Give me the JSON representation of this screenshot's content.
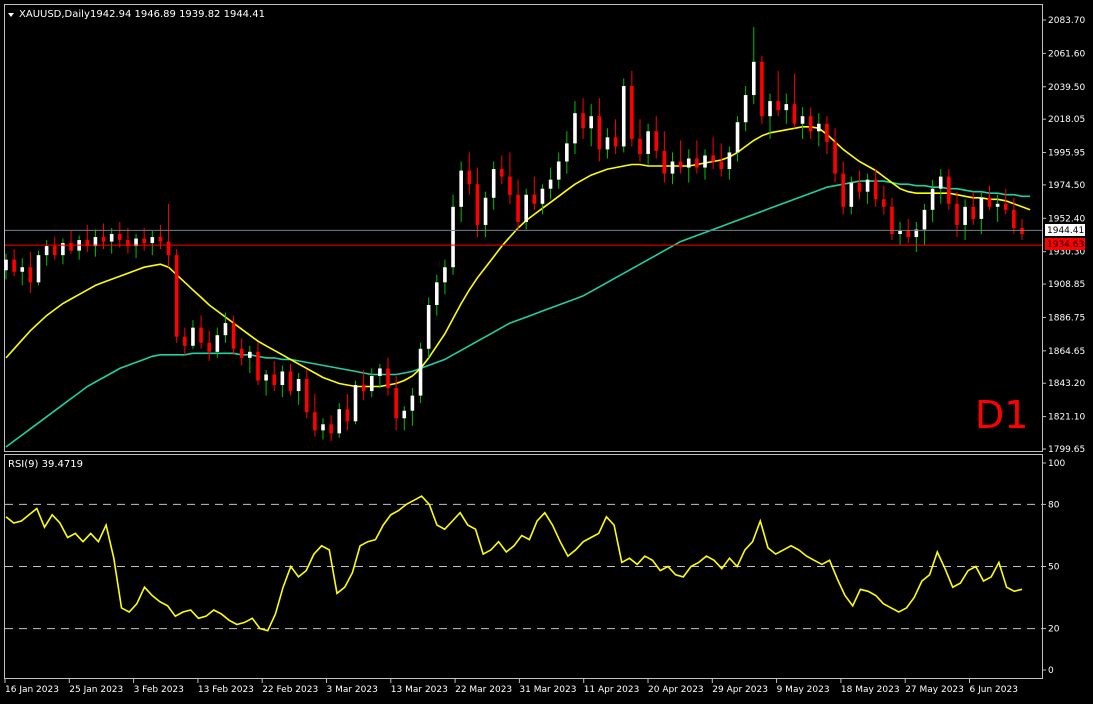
{
  "header": {
    "symbol_label": "XAUUSD,Daily",
    "ohlc_values": "1942.94 1946.89 1939.82 1944.41"
  },
  "timeframe_label": "D1",
  "price_tags": {
    "bid": "1944.41",
    "level": "1934.63"
  },
  "indicator": {
    "label": "RSI(9) 39.4719"
  },
  "colors": {
    "background": "#000000",
    "frame": "#c0c0c0",
    "bull_candle_body": "#ffffff",
    "bull_candle_wick": "#00c000",
    "bear_candle_body": "#ff0000",
    "bear_candle_wick": "#ff0000",
    "ma_fast": "#ffff00",
    "ma_slow": "#20d0a0",
    "rsi_line": "#ffff00",
    "level_line": "#ff0000",
    "bid_line": "#708090",
    "timeframe_label": "#ff0000",
    "axis_text": "#ffffff"
  },
  "chart_data": [
    {
      "type": "candlestick",
      "title": "XAUUSD,Daily",
      "y_ticks": [
        "2083.70",
        "2061.60",
        "2039.50",
        "2018.05",
        "1995.95",
        "1974.50",
        "1952.40",
        "1930.30",
        "1908.85",
        "1886.75",
        "1864.65",
        "1843.20",
        "1821.10",
        "1799.65"
      ],
      "ylim": [
        1799.65,
        2083.7
      ],
      "x_ticks": [
        "16 Jan 2023",
        "25 Jan 2023",
        "3 Feb 2023",
        "13 Feb 2023",
        "22 Feb 2023",
        "3 Mar 2023",
        "13 Mar 2023",
        "22 Mar 2023",
        "31 Mar 2023",
        "11 Apr 2023",
        "20 Apr 2023",
        "29 Apr 2023",
        "9 May 2023",
        "18 May 2023",
        "27 May 2023",
        "6 Jun 2023"
      ],
      "horizontal_levels": [
        1944.41,
        1934.63
      ],
      "candles": [
        [
          1918,
          1929,
          1912,
          1925
        ],
        [
          1925,
          1932,
          1914,
          1917
        ],
        [
          1917,
          1926,
          1908,
          1920
        ],
        [
          1920,
          1930,
          1903,
          1910
        ],
        [
          1910,
          1931,
          1908,
          1928
        ],
        [
          1928,
          1938,
          1921,
          1934
        ],
        [
          1934,
          1940,
          1925,
          1928
        ],
        [
          1928,
          1939,
          1922,
          1936
        ],
        [
          1936,
          1944,
          1929,
          1931
        ],
        [
          1931,
          1941,
          1925,
          1938
        ],
        [
          1938,
          1948,
          1930,
          1934
        ],
        [
          1934,
          1945,
          1927,
          1940
        ],
        [
          1940,
          1949,
          1932,
          1937
        ],
        [
          1937,
          1946,
          1929,
          1942
        ],
        [
          1942,
          1950,
          1933,
          1938
        ],
        [
          1938,
          1946,
          1929,
          1934
        ],
        [
          1934,
          1942,
          1926,
          1939
        ],
        [
          1939,
          1946,
          1931,
          1936
        ],
        [
          1936,
          1944,
          1928,
          1940
        ],
        [
          1940,
          1948,
          1932,
          1937
        ],
        [
          1937,
          1962,
          1920,
          1928
        ],
        [
          1928,
          1932,
          1870,
          1874
        ],
        [
          1874,
          1880,
          1862,
          1868
        ],
        [
          1868,
          1885,
          1866,
          1880
        ],
        [
          1880,
          1888,
          1866,
          1870
        ],
        [
          1870,
          1878,
          1858,
          1864
        ],
        [
          1864,
          1880,
          1860,
          1875
        ],
        [
          1875,
          1890,
          1870,
          1883
        ],
        [
          1883,
          1888,
          1862,
          1866
        ],
        [
          1866,
          1873,
          1855,
          1860
        ],
        [
          1860,
          1868,
          1850,
          1864
        ],
        [
          1864,
          1870,
          1842,
          1845
        ],
        [
          1845,
          1852,
          1835,
          1849
        ],
        [
          1849,
          1858,
          1838,
          1842
        ],
        [
          1842,
          1855,
          1834,
          1851
        ],
        [
          1851,
          1856,
          1835,
          1838
        ],
        [
          1838,
          1850,
          1829,
          1846
        ],
        [
          1846,
          1852,
          1820,
          1824
        ],
        [
          1824,
          1836,
          1808,
          1812
        ],
        [
          1812,
          1820,
          1806,
          1816
        ],
        [
          1816,
          1822,
          1805,
          1810
        ],
        [
          1810,
          1830,
          1807,
          1826
        ],
        [
          1826,
          1836,
          1812,
          1818
        ],
        [
          1818,
          1845,
          1816,
          1842
        ],
        [
          1842,
          1852,
          1832,
          1838
        ],
        [
          1838,
          1853,
          1834,
          1848
        ],
        [
          1848,
          1856,
          1840,
          1853
        ],
        [
          1853,
          1860,
          1835,
          1840
        ],
        [
          1840,
          1848,
          1812,
          1820
        ],
        [
          1820,
          1828,
          1812,
          1825
        ],
        [
          1825,
          1840,
          1815,
          1835
        ],
        [
          1835,
          1870,
          1830,
          1866
        ],
        [
          1866,
          1900,
          1860,
          1895
        ],
        [
          1895,
          1915,
          1888,
          1910
        ],
        [
          1910,
          1925,
          1902,
          1920
        ],
        [
          1920,
          1968,
          1915,
          1960
        ],
        [
          1960,
          1990,
          1950,
          1984
        ],
        [
          1984,
          1996,
          1968,
          1975
        ],
        [
          1975,
          1986,
          1940,
          1948
        ],
        [
          1948,
          1970,
          1940,
          1966
        ],
        [
          1966,
          1990,
          1958,
          1985
        ],
        [
          1985,
          1994,
          1975,
          1980
        ],
        [
          1980,
          1996,
          1962,
          1968
        ],
        [
          1968,
          1978,
          1945,
          1950
        ],
        [
          1950,
          1972,
          1945,
          1968
        ],
        [
          1968,
          1980,
          1958,
          1962
        ],
        [
          1962,
          1975,
          1955,
          1972
        ],
        [
          1972,
          1986,
          1965,
          1978
        ],
        [
          1978,
          1996,
          1972,
          1990
        ],
        [
          1990,
          2010,
          1982,
          2002
        ],
        [
          2002,
          2030,
          1995,
          2022
        ],
        [
          2022,
          2032,
          2005,
          2012
        ],
        [
          2012,
          2028,
          2000,
          2020
        ],
        [
          2020,
          2032,
          1990,
          1998
        ],
        [
          1998,
          2012,
          1992,
          2006
        ],
        [
          2006,
          2018,
          1995,
          2000
        ],
        [
          2000,
          2045,
          1996,
          2040
        ],
        [
          2040,
          2050,
          2000,
          2005
        ],
        [
          2005,
          2018,
          1990,
          1995
        ],
        [
          1995,
          2015,
          1988,
          2010
        ],
        [
          2010,
          2020,
          1992,
          1997
        ],
        [
          1997,
          2010,
          1976,
          1982
        ],
        [
          1982,
          1996,
          1975,
          1990
        ],
        [
          1990,
          2004,
          1982,
          1986
        ],
        [
          1986,
          1998,
          1976,
          1992
        ],
        [
          1992,
          2004,
          1982,
          1986
        ],
        [
          1986,
          1998,
          1978,
          1994
        ],
        [
          1994,
          2006,
          1985,
          1990
        ],
        [
          1990,
          2002,
          1980,
          1985
        ],
        [
          1985,
          2000,
          1978,
          1996
        ],
        [
          1996,
          2020,
          1990,
          2016
        ],
        [
          2016,
          2040,
          2010,
          2034
        ],
        [
          2034,
          2079,
          2028,
          2056
        ],
        [
          2056,
          2060,
          2015,
          2020
        ],
        [
          2020,
          2035,
          2005,
          2030
        ],
        [
          2030,
          2050,
          2020,
          2024
        ],
        [
          2024,
          2035,
          2015,
          2028
        ],
        [
          2028,
          2048,
          2012,
          2015
        ],
        [
          2015,
          2026,
          2005,
          2020
        ],
        [
          2020,
          2026,
          2005,
          2010
        ],
        [
          2010,
          2022,
          2000,
          2015
        ],
        [
          2015,
          2020,
          1995,
          2003
        ],
        [
          2003,
          2012,
          1976,
          1982
        ],
        [
          1982,
          1990,
          1955,
          1960
        ],
        [
          1960,
          1980,
          1955,
          1976
        ],
        [
          1976,
          1984,
          1965,
          1970
        ],
        [
          1970,
          1982,
          1962,
          1978
        ],
        [
          1978,
          1985,
          1960,
          1965
        ],
        [
          1965,
          1974,
          1955,
          1960
        ],
        [
          1960,
          1966,
          1938,
          1942
        ],
        [
          1942,
          1950,
          1935,
          1944
        ],
        [
          1944,
          1952,
          1936,
          1940
        ],
        [
          1940,
          1950,
          1930,
          1945
        ],
        [
          1945,
          1962,
          1935,
          1958
        ],
        [
          1958,
          1978,
          1950,
          1972
        ],
        [
          1972,
          1985,
          1962,
          1980
        ],
        [
          1980,
          1985,
          1958,
          1962
        ],
        [
          1962,
          1970,
          1940,
          1948
        ],
        [
          1948,
          1965,
          1938,
          1960
        ],
        [
          1960,
          1970,
          1948,
          1952
        ],
        [
          1952,
          1970,
          1942,
          1966
        ],
        [
          1966,
          1974,
          1958,
          1960
        ],
        [
          1960,
          1968,
          1950,
          1962
        ],
        [
          1962,
          1972,
          1955,
          1958
        ],
        [
          1958,
          1966,
          1942,
          1946
        ],
        [
          1946,
          1952,
          1938,
          1942
        ]
      ],
      "series": [
        {
          "type": "line",
          "color": "#ffff00",
          "values": [
            1860,
            1866,
            1872,
            1878,
            1883,
            1888,
            1892,
            1896,
            1899,
            1902,
            1905,
            1908,
            1910,
            1912,
            1914,
            1916,
            1918,
            1920,
            1921,
            1922,
            1920,
            1915,
            1910,
            1905,
            1900,
            1895,
            1891,
            1887,
            1883,
            1879,
            1875,
            1871,
            1868,
            1865,
            1862,
            1859,
            1856,
            1853,
            1850,
            1847,
            1845,
            1843,
            1842,
            1841,
            1841,
            1841,
            1841,
            1842,
            1843,
            1845,
            1848,
            1853,
            1860,
            1868,
            1876,
            1886,
            1896,
            1905,
            1913,
            1920,
            1927,
            1934,
            1940,
            1946,
            1951,
            1955,
            1959,
            1963,
            1967,
            1971,
            1975,
            1978,
            1981,
            1983,
            1985,
            1986,
            1987,
            1988,
            1988,
            1987,
            1987,
            1987,
            1987,
            1987,
            1987,
            1988,
            1989,
            1990,
            1991,
            1993,
            1996,
            2000,
            2004,
            2007,
            2009,
            2010,
            2011,
            2012,
            2013,
            2013,
            2012,
            2008,
            2003,
            1998,
            1994,
            1990,
            1987,
            1984,
            1980,
            1976,
            1972,
            1970,
            1969,
            1969,
            1969,
            1969,
            1969,
            1968,
            1967,
            1966,
            1966,
            1965,
            1965,
            1964,
            1962,
            1960,
            1958
          ]
        },
        {
          "type": "line",
          "color": "#20d0a0",
          "values": [
            1801,
            1805,
            1809,
            1813,
            1817,
            1821,
            1825,
            1829,
            1833,
            1837,
            1841,
            1844,
            1847,
            1850,
            1853,
            1855,
            1857,
            1859,
            1861,
            1862,
            1862,
            1862,
            1862,
            1863,
            1863,
            1863,
            1863,
            1863,
            1863,
            1862,
            1862,
            1861,
            1860,
            1860,
            1859,
            1859,
            1858,
            1857,
            1856,
            1855,
            1854,
            1853,
            1852,
            1851,
            1850,
            1849,
            1849,
            1849,
            1849,
            1850,
            1851,
            1853,
            1855,
            1857,
            1859,
            1862,
            1865,
            1868,
            1871,
            1874,
            1877,
            1880,
            1883,
            1885,
            1887,
            1889,
            1891,
            1893,
            1895,
            1897,
            1899,
            1901,
            1904,
            1907,
            1910,
            1913,
            1916,
            1919,
            1922,
            1925,
            1928,
            1931,
            1934,
            1937,
            1939,
            1941,
            1943,
            1945,
            1947,
            1949,
            1951,
            1953,
            1955,
            1957,
            1959,
            1961,
            1963,
            1965,
            1967,
            1969,
            1971,
            1973,
            1974,
            1975,
            1976,
            1977,
            1977,
            1977,
            1977,
            1976,
            1975,
            1975,
            1974,
            1974,
            1973,
            1973,
            1972,
            1972,
            1971,
            1970,
            1970,
            1969,
            1969,
            1968,
            1968,
            1967,
            1967
          ]
        }
      ]
    },
    {
      "type": "line",
      "title": "RSI(9) 39.4719",
      "y_ticks": [
        "100",
        "80",
        "50",
        "20",
        "0"
      ],
      "ylim": [
        0,
        100
      ],
      "series": [
        {
          "values": [
            74,
            71,
            72,
            75,
            78,
            69,
            75,
            71,
            64,
            66,
            62,
            66,
            62,
            70,
            54,
            30,
            28,
            32,
            40,
            36,
            33,
            31,
            26,
            28,
            29,
            25,
            26,
            29,
            27,
            24,
            22,
            23,
            25,
            20,
            19,
            27,
            40,
            50,
            45,
            48,
            56,
            60,
            58,
            37,
            40,
            47,
            60,
            62,
            63,
            70,
            75,
            77,
            80,
            82,
            84,
            80,
            70,
            68,
            72,
            76,
            70,
            68,
            56,
            58,
            62,
            57,
            60,
            65,
            63,
            72,
            76,
            70,
            62,
            55,
            58,
            62,
            64,
            66,
            74,
            70,
            52,
            54,
            51,
            55,
            53,
            48,
            50,
            46,
            45,
            50,
            52,
            55,
            53,
            49,
            54,
            50,
            58,
            62,
            72,
            59,
            56,
            58,
            60,
            58,
            55,
            53,
            51,
            53,
            44,
            36,
            31,
            39,
            38,
            36,
            32,
            30,
            28,
            30,
            35,
            43,
            46,
            57,
            49,
            40,
            42,
            48,
            50,
            43,
            45,
            52,
            40,
            38,
            39
          ]
        }
      ],
      "levels": [
        80,
        50,
        20
      ]
    }
  ]
}
